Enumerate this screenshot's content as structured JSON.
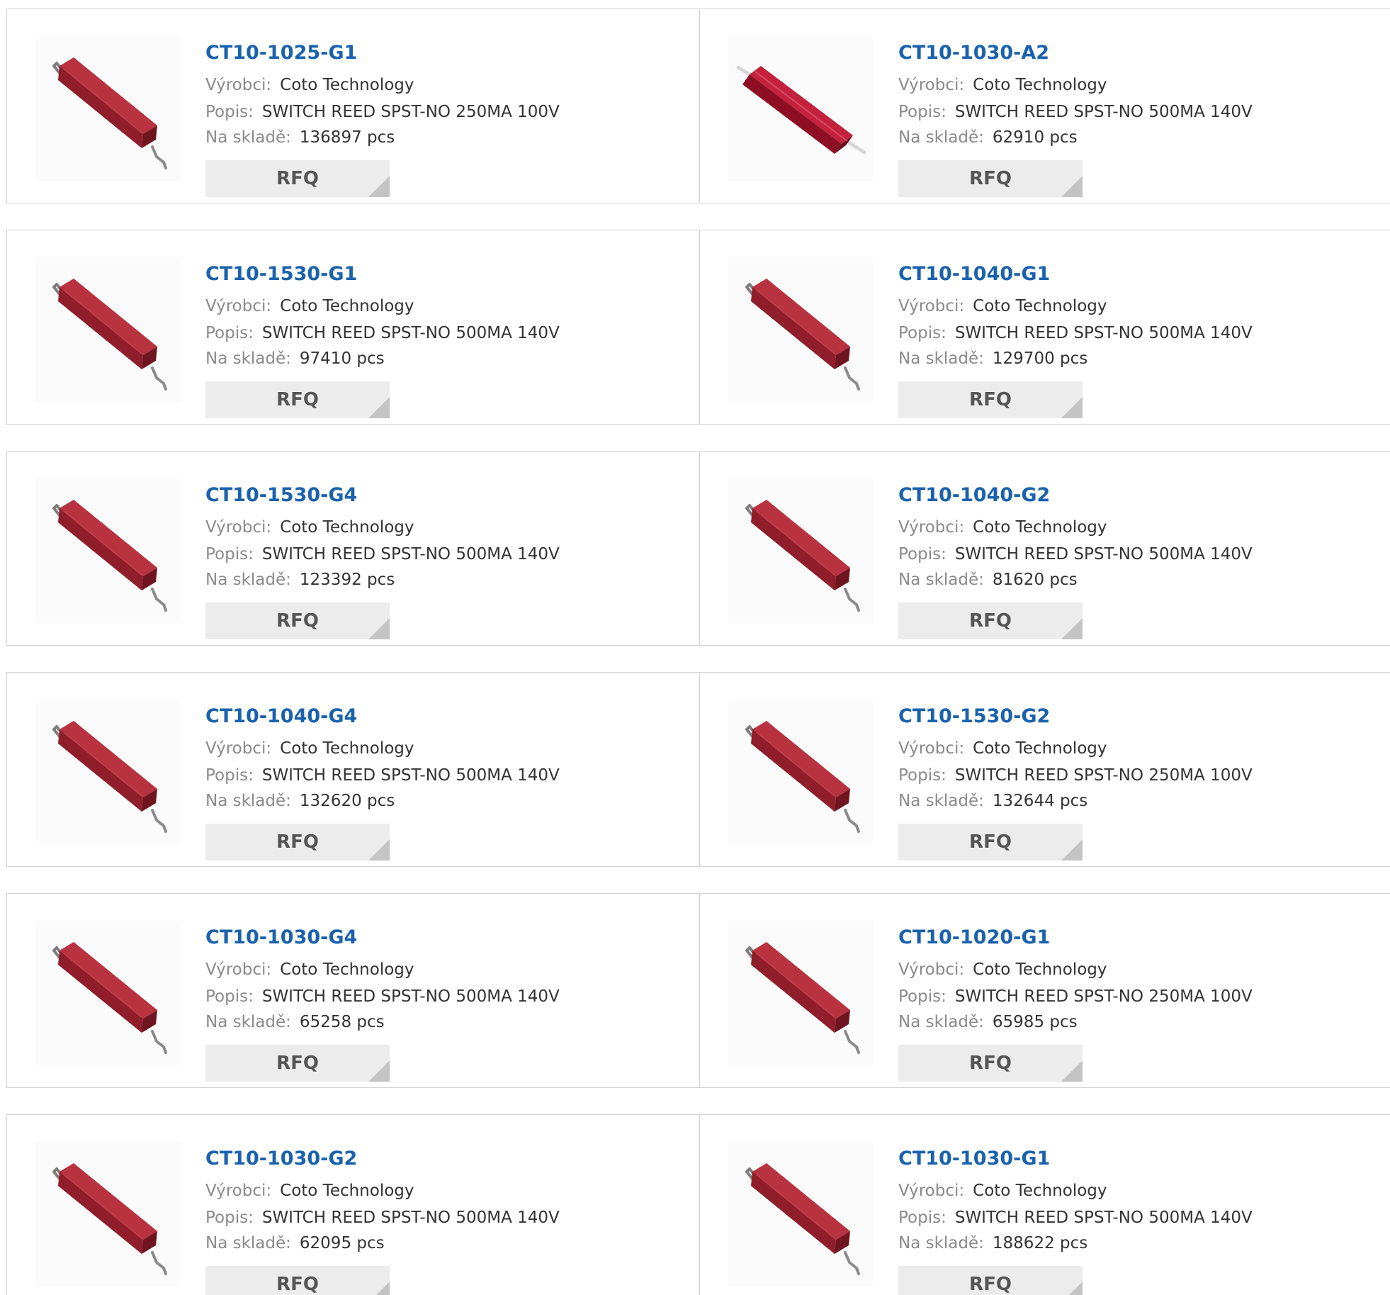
{
  "labels": {
    "manufacturer": "Výrobci:",
    "description": "Popis:",
    "stock": "Na skladě:",
    "rfq": "RFQ"
  },
  "colors": {
    "part_link": "#1a62ad",
    "body_red": "#9b1b2a",
    "rfq_bg": "#ececec"
  },
  "products": [
    {
      "part": "CT10-1025-G1",
      "manufacturer": "Coto Technology",
      "description": "SWITCH REED SPST-NO 250MA 100V",
      "stock": "136897 pcs",
      "image": "reed-switch-gullwing-icon"
    },
    {
      "part": "CT10-1030-A2",
      "manufacturer": "Coto Technology",
      "description": "SWITCH REED SPST-NO 500MA 140V",
      "stock": "62910 pcs",
      "image": "reed-switch-axial-icon"
    },
    {
      "part": "CT10-1530-G1",
      "manufacturer": "Coto Technology",
      "description": "SWITCH REED SPST-NO 500MA 140V",
      "stock": "97410 pcs",
      "image": "reed-switch-gullwing-icon"
    },
    {
      "part": "CT10-1040-G1",
      "manufacturer": "Coto Technology",
      "description": "SWITCH REED SPST-NO 500MA 140V",
      "stock": "129700 pcs",
      "image": "reed-switch-gullwing-icon"
    },
    {
      "part": "CT10-1530-G4",
      "manufacturer": "Coto Technology",
      "description": "SWITCH REED SPST-NO 500MA 140V",
      "stock": "123392 pcs",
      "image": "reed-switch-gullwing-icon"
    },
    {
      "part": "CT10-1040-G2",
      "manufacturer": "Coto Technology",
      "description": "SWITCH REED SPST-NO 500MA 140V",
      "stock": "81620 pcs",
      "image": "reed-switch-gullwing-icon"
    },
    {
      "part": "CT10-1040-G4",
      "manufacturer": "Coto Technology",
      "description": "SWITCH REED SPST-NO 500MA 140V",
      "stock": "132620 pcs",
      "image": "reed-switch-gullwing-icon"
    },
    {
      "part": "CT10-1530-G2",
      "manufacturer": "Coto Technology",
      "description": "SWITCH REED SPST-NO 250MA 100V",
      "stock": "132644 pcs",
      "image": "reed-switch-gullwing-icon"
    },
    {
      "part": "CT10-1030-G4",
      "manufacturer": "Coto Technology",
      "description": "SWITCH REED SPST-NO 500MA 140V",
      "stock": "65258 pcs",
      "image": "reed-switch-gullwing-icon"
    },
    {
      "part": "CT10-1020-G1",
      "manufacturer": "Coto Technology",
      "description": "SWITCH REED SPST-NO 250MA 100V",
      "stock": "65985 pcs",
      "image": "reed-switch-gullwing-icon"
    },
    {
      "part": "CT10-1030-G2",
      "manufacturer": "Coto Technology",
      "description": "SWITCH REED SPST-NO 500MA 140V",
      "stock": "62095 pcs",
      "image": "reed-switch-gullwing-icon"
    },
    {
      "part": "CT10-1030-G1",
      "manufacturer": "Coto Technology",
      "description": "SWITCH REED SPST-NO 500MA 140V",
      "stock": "188622 pcs",
      "image": "reed-switch-gullwing-icon"
    }
  ]
}
